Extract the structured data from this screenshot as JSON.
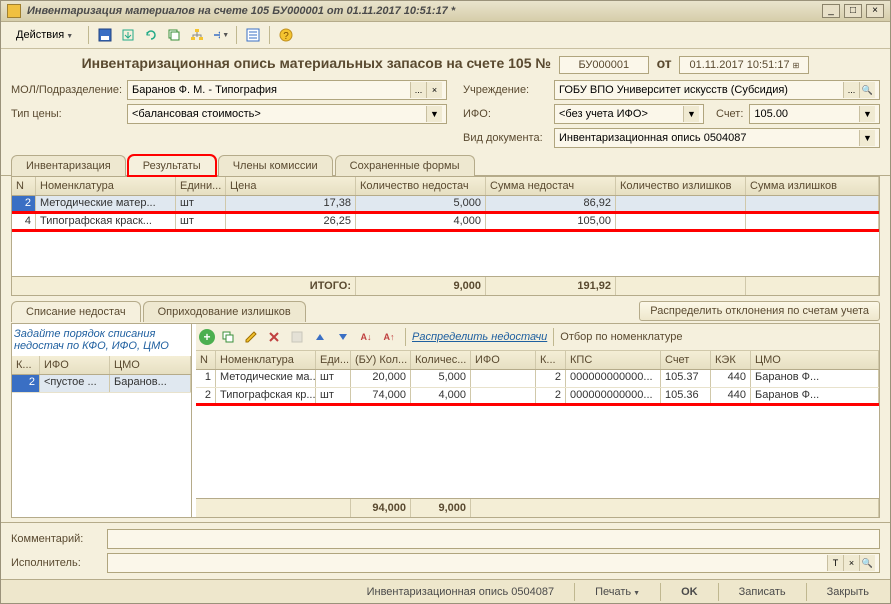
{
  "window": {
    "title": "Инвентаризация материалов на счете 105 БУ000001 от 01.11.2017 10:51:17 *"
  },
  "toolbar": {
    "actions_label": "Действия"
  },
  "header": {
    "title_prefix": "Инвентаризационная опись материальных запасов на счете 105 №",
    "number": "БУ000001",
    "from_label": "от",
    "date": "01.11.2017 10:51:17"
  },
  "fields": {
    "mol_label": "МОЛ/Подразделение:",
    "mol_value": "Баранов Ф. М. - Типография",
    "org_label": "Учреждение:",
    "org_value": "ГОБУ ВПО Университет искусств (Субсидия)",
    "price_type_label": "Тип цены:",
    "price_type_value": "<балансовая стоимость>",
    "ifo_label": "ИФО:",
    "ifo_value": "<без учета ИФО>",
    "account_label": "Счет:",
    "account_value": "105.00",
    "doctype_label": "Вид документа:",
    "doctype_value": "Инвентаризационная опись 0504087"
  },
  "tabs": {
    "t1": "Инвентаризация",
    "t2": "Результаты",
    "t3": "Члены комиссии",
    "t4": "Сохраненные формы"
  },
  "grid1": {
    "headers": {
      "n": "N",
      "nom": "Номенклатура",
      "unit": "Едини...",
      "price": "Цена",
      "qty_short": "Количество недостач",
      "sum_short": "Сумма недостач",
      "qty_over": "Количество излишков",
      "sum_over": "Сумма излишков"
    },
    "rows": [
      {
        "n": "2",
        "nom": "Методические матер...",
        "unit": "шт",
        "price": "17,38",
        "qshort": "5,000",
        "sshort": "86,92",
        "qover": "",
        "sover": ""
      },
      {
        "n": "4",
        "nom": "Типографская краск...",
        "unit": "шт",
        "price": "26,25",
        "qshort": "4,000",
        "sshort": "105,00",
        "qover": "",
        "sover": ""
      }
    ],
    "footer": {
      "label": "ИТОГО:",
      "qshort": "9,000",
      "sshort": "191,92"
    }
  },
  "subtabs": {
    "s1": "Списание недостач",
    "s2": "Оприходование излишков",
    "dist_button": "Распределить отклонения по счетам учета"
  },
  "left_panel": {
    "hint": "Задайте порядок списания недостач по КФО, ИФО, ЦМО",
    "headers": {
      "k": "К...",
      "ifo": "ИФО",
      "cmo": "ЦМО"
    },
    "row": {
      "k": "2",
      "ifo": "<пустое ...",
      "cmo": "Баранов..."
    }
  },
  "right_toolbar": {
    "dist_shortage": "Распределить недостачи",
    "filter": "Отбор по номенклатуре"
  },
  "grid2": {
    "headers": {
      "n": "N",
      "nom": "Номенклатура",
      "unit": "Еди...",
      "bu": "(БУ) Кол...",
      "qty": "Количес...",
      "ifo": "ИФО",
      "k": "К...",
      "kps": "КПС",
      "acct": "Счет",
      "kek": "КЭК",
      "cmo": "ЦМО"
    },
    "rows": [
      {
        "n": "1",
        "nom": "Методические ма...",
        "unit": "шт",
        "bu": "20,000",
        "qty": "5,000",
        "ifo": "",
        "k": "2",
        "kps": "000000000000...",
        "acct": "105.37",
        "kek": "440",
        "cmo": "Баранов Ф..."
      },
      {
        "n": "2",
        "nom": "Типографская кр...",
        "unit": "шт",
        "bu": "74,000",
        "qty": "4,000",
        "ifo": "",
        "k": "2",
        "kps": "000000000000...",
        "acct": "105.36",
        "kek": "440",
        "cmo": "Баранов Ф..."
      }
    ],
    "footer": {
      "bu": "94,000",
      "qty": "9,000"
    }
  },
  "bottom": {
    "comment_label": "Комментарий:",
    "executor_label": "Исполнитель:"
  },
  "status": {
    "doc": "Инвентаризационная опись 0504087",
    "print": "Печать",
    "ok": "OK",
    "save": "Записать",
    "close": "Закрыть"
  }
}
